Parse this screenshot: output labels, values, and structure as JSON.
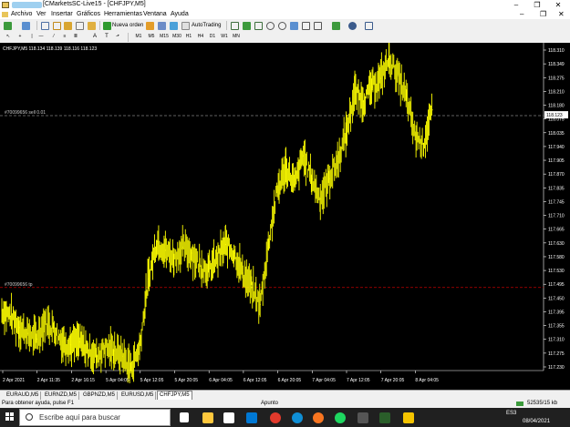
{
  "window": {
    "title": "[CMarketsSC-Live15 - [CHFJPY,M5]",
    "controls": [
      "–",
      "❐",
      "✕"
    ]
  },
  "menu": [
    "Archivo",
    "Ver",
    "Insertar",
    "Gráficos",
    "Herramientas",
    "Ventana",
    "Ayuda"
  ],
  "toolbar": {
    "new_order_label": "Nueva orden",
    "autotrading_label": "AutoTrading",
    "timeframes": [
      "M1",
      "M5",
      "M15",
      "M30",
      "H1",
      "H4",
      "D1",
      "W1",
      "MN"
    ],
    "drawing_tools": [
      "A",
      "T"
    ]
  },
  "chart": {
    "header": "CHFJPY,M5  118.134 118.139 118.116 118.123",
    "sell_line_label": "#70099656 sell 0.01",
    "tp_line_label": "#70099656 tp",
    "current_price_label": "118.123",
    "colors": {
      "bars": "#ffff00",
      "background": "#000000",
      "sell_line": "#808080",
      "tp_line": "#c00000"
    }
  },
  "chart_data": {
    "type": "line",
    "title": "CHFJPY,M5",
    "x_tick_labels": [
      "2 Apr 2021",
      "2 Apr 11:35",
      "2 Apr 16:15",
      "5 Apr 04:05",
      "5 Apr 12:05",
      "5 Apr 20:05",
      "6 Apr 04:05",
      "6 Apr 12:05",
      "6 Apr 20:05",
      "7 Apr 04:05",
      "7 Apr 12:05",
      "7 Apr 20:05",
      "8 Apr 04:05"
    ],
    "y_tick_labels": [
      "118.310",
      "118.349",
      "118.275",
      "118.210",
      "118.180",
      "118.075",
      "118.035",
      "117.940",
      "117.905",
      "117.870",
      "117.835",
      "117.745",
      "117.710",
      "117.665",
      "117.630",
      "117.580",
      "117.530",
      "117.495",
      "117.450",
      "117.395",
      "117.355",
      "117.310",
      "117.275",
      "117.230"
    ],
    "ylim": [
      117.23,
      118.349
    ],
    "levels": {
      "sell": 118.12,
      "tp": 117.52,
      "current": 118.123
    },
    "series": [
      {
        "x": [
          0,
          2,
          4,
          6,
          8,
          10,
          12,
          14,
          16,
          18,
          20,
          22,
          24,
          26,
          28,
          30,
          32,
          34,
          36,
          38,
          40,
          42,
          44,
          46,
          48,
          50,
          52,
          54,
          56,
          58,
          60,
          62,
          64,
          66,
          68,
          70,
          72,
          74,
          76,
          78,
          80,
          82,
          84,
          86,
          88,
          90,
          92,
          94,
          96,
          98,
          100
        ],
        "values": [
          117.44,
          117.42,
          117.38,
          117.36,
          117.34,
          117.4,
          117.38,
          117.33,
          117.32,
          117.33,
          117.3,
          117.28,
          117.31,
          117.3,
          117.28,
          117.24,
          117.31,
          117.55,
          117.68,
          117.65,
          117.62,
          117.66,
          117.64,
          117.6,
          117.58,
          117.62,
          117.67,
          117.64,
          117.57,
          117.52,
          117.46,
          117.68,
          117.86,
          117.94,
          117.88,
          117.98,
          117.9,
          117.83,
          117.9,
          117.96,
          118.06,
          118.2,
          118.17,
          118.22,
          118.25,
          118.32,
          118.26,
          118.18,
          118.05,
          118.02,
          118.14
        ]
      }
    ]
  },
  "tabs": [
    "EURAUD,M5",
    "EURNZD,M5",
    "GBPNZD,M5",
    "EURUSD,M5",
    "CHFJPY,M5"
  ],
  "active_tab": "CHFJPY,M5",
  "status": {
    "help": "Para obtener ayuda, pulse F1",
    "mode": "Apunto",
    "traffic": "52535/15 kb"
  },
  "taskbar": {
    "search_placeholder": "Escribe aquí para buscar",
    "language": "ES3",
    "date": "08/04/2021"
  }
}
